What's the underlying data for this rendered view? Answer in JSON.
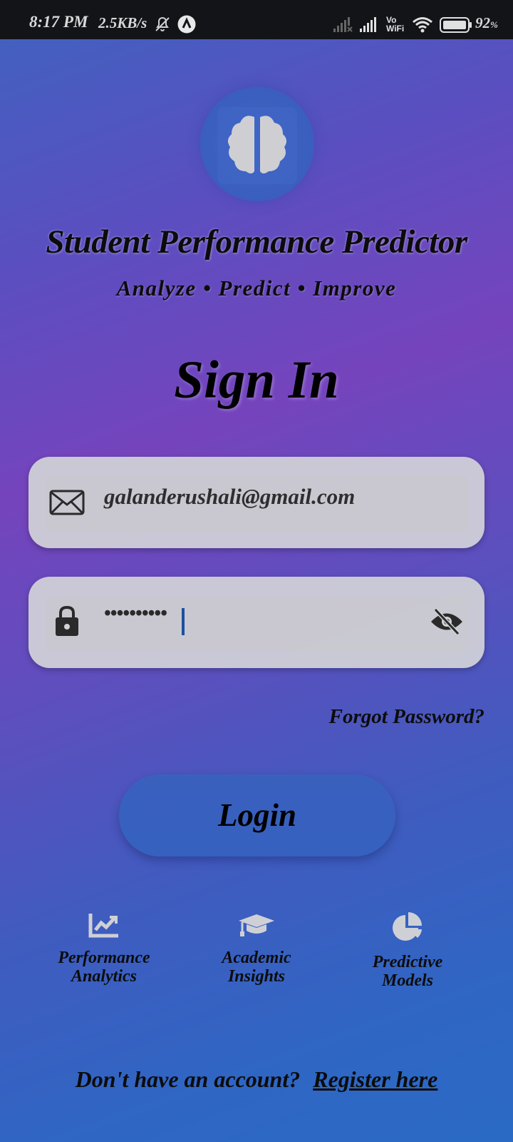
{
  "status_bar": {
    "time": "8:17 PM",
    "net_speed": "2.5KB/s",
    "battery_level": "92",
    "battery_unit": "%",
    "icons": [
      "bell-off-icon",
      "app-notification-icon",
      "signal-sim1-icon",
      "signal-sim2-icon",
      "vowifi-icon",
      "wifi-icon",
      "battery-icon"
    ]
  },
  "header": {
    "logo_icon": "brain-icon",
    "app_title": "Student Performance Predictor",
    "tagline": "Analyze • Predict • Improve"
  },
  "form": {
    "heading": "Sign In",
    "email": {
      "value": "galanderushali@gmail.com",
      "icon": "mail-icon"
    },
    "password": {
      "value": "••••••••••",
      "icon": "lock-icon",
      "toggle_icon": "eye-off-icon"
    },
    "forgot_label": "Forgot Password?",
    "login_label": "Login"
  },
  "features": [
    {
      "label": "Performance\nAnalytics",
      "icon": "line-chart-icon"
    },
    {
      "label": "Academic\nInsights",
      "icon": "graduation-cap-icon"
    },
    {
      "label": "Predictive\nModels",
      "icon": "pie-chart-icon"
    }
  ],
  "footer": {
    "prompt": "Don't have an account?",
    "register_label": "Register here"
  },
  "colors": {
    "status_bar_bg": "#121418",
    "gradient_top": "#3f63bf",
    "gradient_mid": "#7544bd",
    "gradient_bottom": "#2a6ac4",
    "field_bg": "#d2d2d7",
    "button_bg": "#3a60be"
  }
}
